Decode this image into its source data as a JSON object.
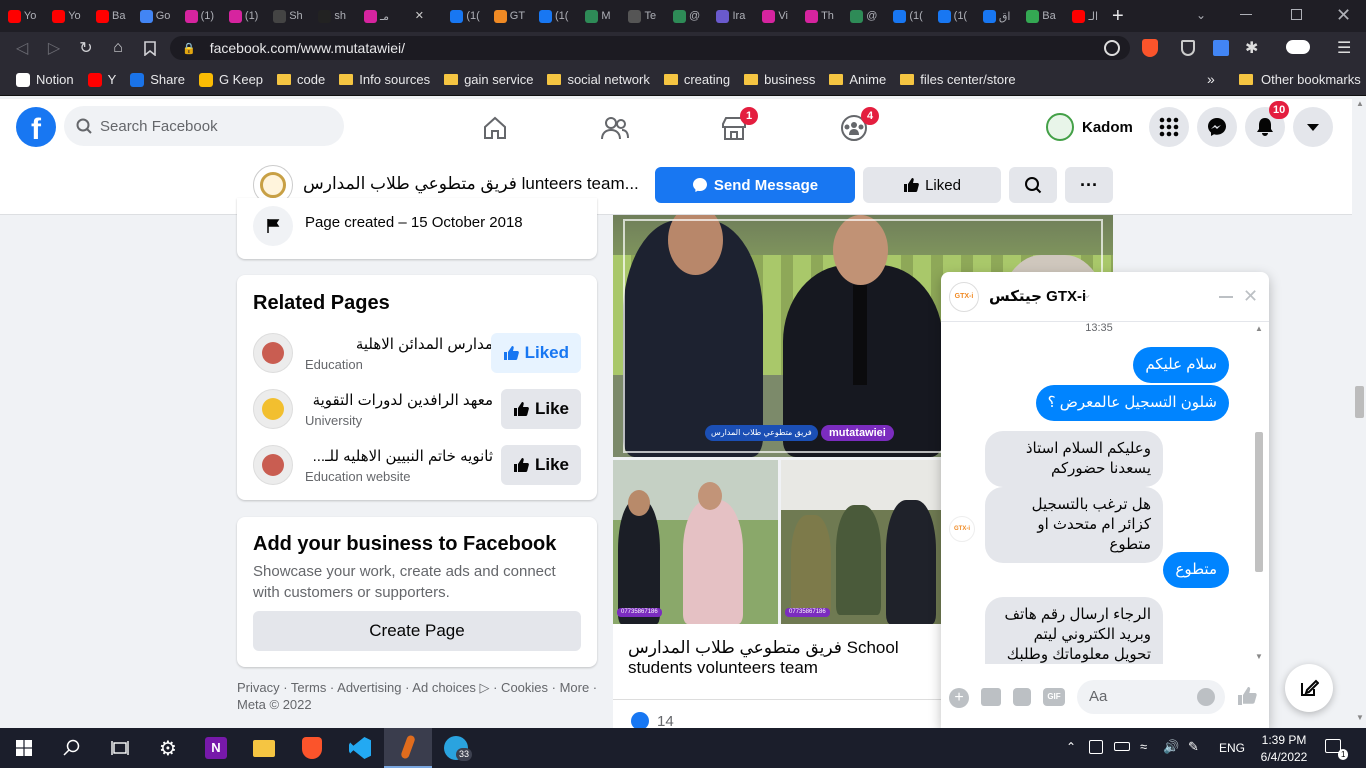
{
  "browser": {
    "tabs": [
      {
        "title": "Yo",
        "favicon": "youtube-icon",
        "color": "#ff0000"
      },
      {
        "title": "Yo",
        "favicon": "youtube-icon",
        "color": "#ff0000"
      },
      {
        "title": "Ba",
        "favicon": "youtube-icon",
        "color": "#ff0000"
      },
      {
        "title": "Go",
        "favicon": "translate-icon",
        "color": "#4285f4"
      },
      {
        "title": "(1)",
        "favicon": "instagram-icon",
        "color": "#d6249f"
      },
      {
        "title": "(1)",
        "favicon": "instagram-icon",
        "color": "#d6249f"
      },
      {
        "title": "Sh",
        "favicon": "me-icon",
        "color": "#444"
      },
      {
        "title": "sh",
        "favicon": "github-icon",
        "color": "#222"
      },
      {
        "title": "مـ",
        "favicon": "instagram-icon",
        "color": "#d6249f"
      },
      {
        "title": "",
        "favicon": "close-icon",
        "color": "transparent"
      },
      {
        "title": "(1(",
        "favicon": "facebook-icon",
        "color": "#1877f2"
      },
      {
        "title": "GT",
        "favicon": "gtx-icon",
        "color": "#f08a24"
      },
      {
        "title": "(1(",
        "favicon": "facebook-icon",
        "color": "#1877f2"
      },
      {
        "title": "M",
        "favicon": "leaf-icon",
        "color": "#2e8b57"
      },
      {
        "title": "Te",
        "favicon": "globe-icon",
        "color": "#555"
      },
      {
        "title": "@",
        "favicon": "leaf-icon",
        "color": "#2e8b57"
      },
      {
        "title": "Ira",
        "favicon": "list-icon",
        "color": "#6a5acd"
      },
      {
        "title": "Vi",
        "favicon": "instagram-icon",
        "color": "#d6249f"
      },
      {
        "title": "Th",
        "favicon": "instagram-icon",
        "color": "#d6249f"
      },
      {
        "title": "@",
        "favicon": "leaf-icon",
        "color": "#2e8b57"
      },
      {
        "title": "(1(",
        "favicon": "facebook-icon",
        "color": "#1877f2"
      },
      {
        "title": "(1(",
        "favicon": "facebook-icon",
        "color": "#1877f2"
      },
      {
        "title": "اق",
        "favicon": "facebook-icon",
        "color": "#1877f2"
      },
      {
        "title": "Ba",
        "favicon": "maps-icon",
        "color": "#34a853"
      },
      {
        "title": "الـ",
        "favicon": "youtube-icon",
        "color": "#ff0000"
      }
    ],
    "new_tab_label": "+",
    "url": "facebook.com/www.mutatawiei/",
    "bookmarks": [
      {
        "label": "Notion",
        "type": "notion"
      },
      {
        "label": "Y",
        "type": "youtube"
      },
      {
        "label": "Share",
        "type": "share"
      },
      {
        "label": "G Keep",
        "type": "keep"
      },
      {
        "label": "code",
        "type": "folder"
      },
      {
        "label": "Info sources",
        "type": "folder"
      },
      {
        "label": "gain service",
        "type": "folder"
      },
      {
        "label": "social network",
        "type": "folder"
      },
      {
        "label": "creating",
        "type": "folder"
      },
      {
        "label": "business",
        "type": "folder"
      },
      {
        "label": "Anime",
        "type": "folder"
      },
      {
        "label": "files center/store",
        "type": "folder"
      }
    ],
    "more_bookmarks": "»",
    "other_bookmarks": "Other bookmarks"
  },
  "fb": {
    "search_placeholder": "Search Facebook",
    "marketplace_badge": "1",
    "groups_badge": "4",
    "notifications_badge": "10",
    "profile_name": "Kadom"
  },
  "page": {
    "title": "فريق متطوعي طلاب المدارس lunteers team...",
    "send_message": "Send Message",
    "liked": "Liked",
    "page_created": "Page created – 15 October 2018",
    "related_title": "Related Pages",
    "related": [
      {
        "name": "مدارس المدائن الاهلية",
        "category": "Education",
        "button": "Liked",
        "liked": true
      },
      {
        "name": "معهد الرافدين لدورات التقوية",
        "category": "University",
        "button": "Like",
        "liked": false
      },
      {
        "name": "ثانويه خاتم النبيين الاهليه للـ...",
        "category": "Education website",
        "button": "Like",
        "liked": false
      }
    ],
    "business_title": "Add your business to Facebook",
    "business_desc": "Showcase your work, create ads and connect with customers or supporters.",
    "create_page": "Create Page",
    "footer_links": "Privacy · Terms · Advertising · Ad choices ▷ · Cookies · More ·",
    "footer_meta": "Meta © 2022",
    "photo_caption_line1": "فريق متطوعي طلاب المدارس School",
    "photo_caption_line2": "students volunteers team",
    "photo_watermark": "mutatawiei",
    "photo_watermark_page": "فريق متطوعي طلاب المدارس",
    "photo_phone": "07735867186",
    "reactions_count": "14"
  },
  "chat": {
    "name": "جيتكس GTX-i",
    "logo_text": "GTX-i",
    "timestamp": "13:35",
    "messages": [
      {
        "from": "me",
        "text": "سلام عليكم"
      },
      {
        "from": "me",
        "text": "شلون التسجيل عالمعرض ؟"
      },
      {
        "from": "them",
        "text": "وعليكم السلام استاذ يسعدنا حضوركم"
      },
      {
        "from": "them",
        "text": "هل ترغب بالتسجيل كزائر ام متحدث او متطوع"
      },
      {
        "from": "me",
        "text": "متطوع"
      },
      {
        "from": "them",
        "text": "الرجاء ارسال رقم هاتف وبريد الكتروني ليتم تحويل معلوماتك وطلبك"
      }
    ],
    "input_placeholder": "Aa"
  },
  "taskbar": {
    "language": "ENG",
    "time": "1:39 PM",
    "date": "6/4/2022",
    "telegram_badge": "33",
    "notifications_count": "1"
  }
}
